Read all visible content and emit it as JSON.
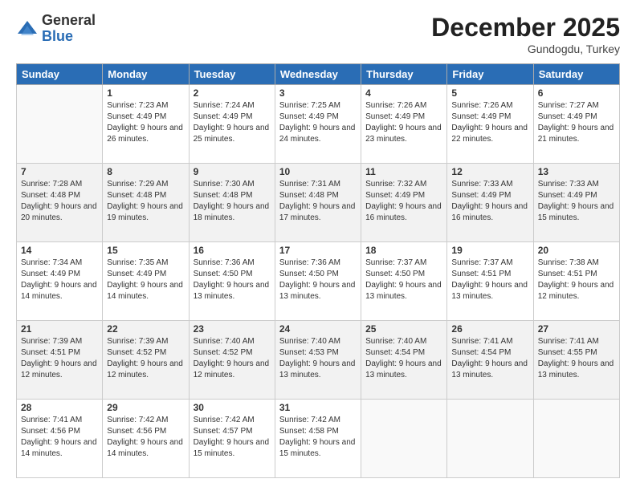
{
  "logo": {
    "general": "General",
    "blue": "Blue"
  },
  "header": {
    "month": "December 2025",
    "location": "Gundogdu, Turkey"
  },
  "days_of_week": [
    "Sunday",
    "Monday",
    "Tuesday",
    "Wednesday",
    "Thursday",
    "Friday",
    "Saturday"
  ],
  "weeks": [
    [
      {
        "day": "",
        "empty": true
      },
      {
        "day": "1",
        "sunrise": "7:23 AM",
        "sunset": "4:49 PM",
        "daylight": "9 hours and 26 minutes."
      },
      {
        "day": "2",
        "sunrise": "7:24 AM",
        "sunset": "4:49 PM",
        "daylight": "9 hours and 25 minutes."
      },
      {
        "day": "3",
        "sunrise": "7:25 AM",
        "sunset": "4:49 PM",
        "daylight": "9 hours and 24 minutes."
      },
      {
        "day": "4",
        "sunrise": "7:26 AM",
        "sunset": "4:49 PM",
        "daylight": "9 hours and 23 minutes."
      },
      {
        "day": "5",
        "sunrise": "7:26 AM",
        "sunset": "4:49 PM",
        "daylight": "9 hours and 22 minutes."
      },
      {
        "day": "6",
        "sunrise": "7:27 AM",
        "sunset": "4:49 PM",
        "daylight": "9 hours and 21 minutes."
      }
    ],
    [
      {
        "day": "7",
        "sunrise": "7:28 AM",
        "sunset": "4:48 PM",
        "daylight": "9 hours and 20 minutes."
      },
      {
        "day": "8",
        "sunrise": "7:29 AM",
        "sunset": "4:48 PM",
        "daylight": "9 hours and 19 minutes."
      },
      {
        "day": "9",
        "sunrise": "7:30 AM",
        "sunset": "4:48 PM",
        "daylight": "9 hours and 18 minutes."
      },
      {
        "day": "10",
        "sunrise": "7:31 AM",
        "sunset": "4:48 PM",
        "daylight": "9 hours and 17 minutes."
      },
      {
        "day": "11",
        "sunrise": "7:32 AM",
        "sunset": "4:49 PM",
        "daylight": "9 hours and 16 minutes."
      },
      {
        "day": "12",
        "sunrise": "7:33 AM",
        "sunset": "4:49 PM",
        "daylight": "9 hours and 16 minutes."
      },
      {
        "day": "13",
        "sunrise": "7:33 AM",
        "sunset": "4:49 PM",
        "daylight": "9 hours and 15 minutes."
      }
    ],
    [
      {
        "day": "14",
        "sunrise": "7:34 AM",
        "sunset": "4:49 PM",
        "daylight": "9 hours and 14 minutes."
      },
      {
        "day": "15",
        "sunrise": "7:35 AM",
        "sunset": "4:49 PM",
        "daylight": "9 hours and 14 minutes."
      },
      {
        "day": "16",
        "sunrise": "7:36 AM",
        "sunset": "4:50 PM",
        "daylight": "9 hours and 13 minutes."
      },
      {
        "day": "17",
        "sunrise": "7:36 AM",
        "sunset": "4:50 PM",
        "daylight": "9 hours and 13 minutes."
      },
      {
        "day": "18",
        "sunrise": "7:37 AM",
        "sunset": "4:50 PM",
        "daylight": "9 hours and 13 minutes."
      },
      {
        "day": "19",
        "sunrise": "7:37 AM",
        "sunset": "4:51 PM",
        "daylight": "9 hours and 13 minutes."
      },
      {
        "day": "20",
        "sunrise": "7:38 AM",
        "sunset": "4:51 PM",
        "daylight": "9 hours and 12 minutes."
      }
    ],
    [
      {
        "day": "21",
        "sunrise": "7:39 AM",
        "sunset": "4:51 PM",
        "daylight": "9 hours and 12 minutes."
      },
      {
        "day": "22",
        "sunrise": "7:39 AM",
        "sunset": "4:52 PM",
        "daylight": "9 hours and 12 minutes."
      },
      {
        "day": "23",
        "sunrise": "7:40 AM",
        "sunset": "4:52 PM",
        "daylight": "9 hours and 12 minutes."
      },
      {
        "day": "24",
        "sunrise": "7:40 AM",
        "sunset": "4:53 PM",
        "daylight": "9 hours and 13 minutes."
      },
      {
        "day": "25",
        "sunrise": "7:40 AM",
        "sunset": "4:54 PM",
        "daylight": "9 hours and 13 minutes."
      },
      {
        "day": "26",
        "sunrise": "7:41 AM",
        "sunset": "4:54 PM",
        "daylight": "9 hours and 13 minutes."
      },
      {
        "day": "27",
        "sunrise": "7:41 AM",
        "sunset": "4:55 PM",
        "daylight": "9 hours and 13 minutes."
      }
    ],
    [
      {
        "day": "28",
        "sunrise": "7:41 AM",
        "sunset": "4:56 PM",
        "daylight": "9 hours and 14 minutes."
      },
      {
        "day": "29",
        "sunrise": "7:42 AM",
        "sunset": "4:56 PM",
        "daylight": "9 hours and 14 minutes."
      },
      {
        "day": "30",
        "sunrise": "7:42 AM",
        "sunset": "4:57 PM",
        "daylight": "9 hours and 15 minutes."
      },
      {
        "day": "31",
        "sunrise": "7:42 AM",
        "sunset": "4:58 PM",
        "daylight": "9 hours and 15 minutes."
      },
      {
        "day": "",
        "empty": true
      },
      {
        "day": "",
        "empty": true
      },
      {
        "day": "",
        "empty": true
      }
    ]
  ]
}
